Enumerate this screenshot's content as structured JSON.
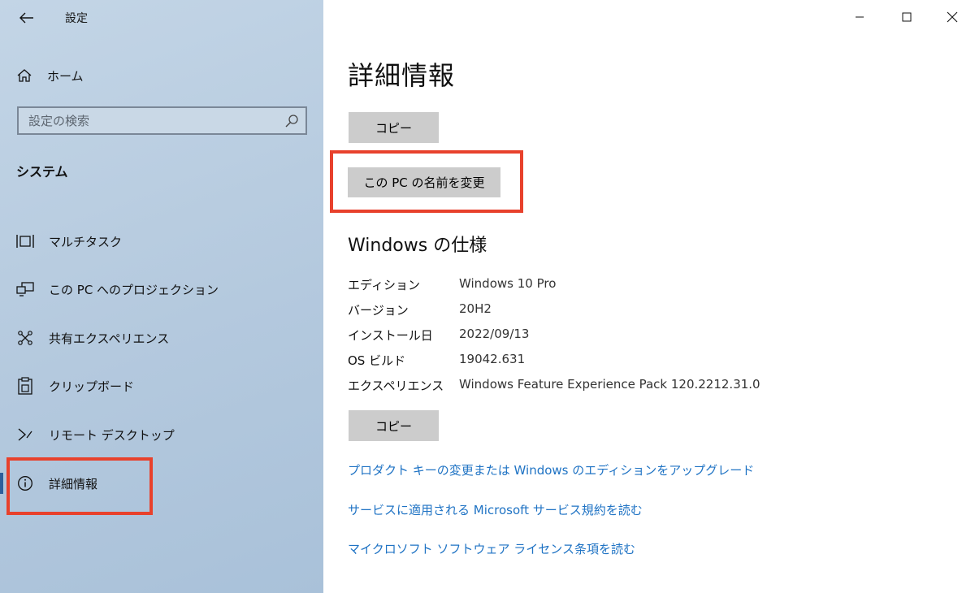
{
  "app": {
    "title": "設定"
  },
  "sidebar": {
    "home_label": "ホーム",
    "search": {
      "placeholder": "設定の検索"
    },
    "section_heading": "システム",
    "items": [
      {
        "label": "マルチタスク",
        "icon": "multitask-icon"
      },
      {
        "label": "この PC へのプロジェクション",
        "icon": "projection-icon"
      },
      {
        "label": "共有エクスペリエンス",
        "icon": "shared-experience-icon"
      },
      {
        "label": "クリップボード",
        "icon": "clipboard-icon"
      },
      {
        "label": "リモート デスクトップ",
        "icon": "remote-desktop-icon"
      },
      {
        "label": "詳細情報",
        "icon": "info-icon",
        "selected": true
      }
    ]
  },
  "content": {
    "title": "詳細情報",
    "copy_button_1": "コピー",
    "rename_button": "この PC の名前を変更",
    "spec_heading": "Windows の仕様",
    "specs": [
      {
        "key": "エディション",
        "value": "Windows 10 Pro"
      },
      {
        "key": "バージョン",
        "value": "20H2"
      },
      {
        "key": "インストール日",
        "value": "2022/09/13"
      },
      {
        "key": "OS ビルド",
        "value": "19042.631"
      },
      {
        "key": "エクスペリエンス",
        "value": "Windows Feature Experience Pack 120.2212.31.0"
      }
    ],
    "copy_button_2": "コピー",
    "links": [
      "プロダクト キーの変更または Windows のエディションをアップグレード",
      "サービスに適用される Microsoft サービス規約を読む",
      "マイクロソフト ソフトウェア ライセンス条項を読む"
    ]
  },
  "colors": {
    "highlight": "#e8412c",
    "link": "#1f73c4",
    "sidebar_bg": "#b4c9de",
    "button_bg": "#cccccc"
  }
}
